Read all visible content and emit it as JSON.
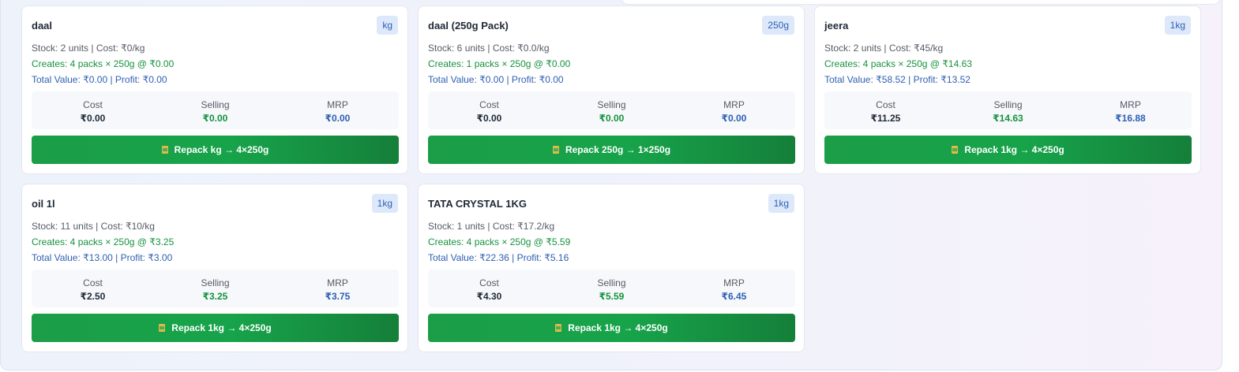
{
  "cards": [
    {
      "title": "daal",
      "badge": "kg",
      "stock": "Stock: 2 units | Cost: ₹0/kg",
      "creates": "Creates: 4 packs × 250g @ ₹0.00",
      "total": "Total Value: ₹0.00 | Profit: ₹0.00",
      "cost_label": "Cost",
      "cost": "₹0.00",
      "selling_label": "Selling",
      "selling": "₹0.00",
      "mrp_label": "MRP",
      "mrp": "₹0.00",
      "button": "Repack kg → 4×250g"
    },
    {
      "title": "daal (250g Pack)",
      "badge": "250g",
      "stock": "Stock: 6 units | Cost: ₹0.0/kg",
      "creates": "Creates: 1 packs × 250g @ ₹0.00",
      "total": "Total Value: ₹0.00 | Profit: ₹0.00",
      "cost_label": "Cost",
      "cost": "₹0.00",
      "selling_label": "Selling",
      "selling": "₹0.00",
      "mrp_label": "MRP",
      "mrp": "₹0.00",
      "button": "Repack 250g → 1×250g"
    },
    {
      "title": "jeera",
      "badge": "1kg",
      "stock": "Stock: 2 units | Cost: ₹45/kg",
      "creates": "Creates: 4 packs × 250g @ ₹14.63",
      "total": "Total Value: ₹58.52 | Profit: ₹13.52",
      "cost_label": "Cost",
      "cost": "₹11.25",
      "selling_label": "Selling",
      "selling": "₹14.63",
      "mrp_label": "MRP",
      "mrp": "₹16.88",
      "button": "Repack 1kg → 4×250g"
    },
    {
      "title": "oil 1l",
      "badge": "1kg",
      "stock": "Stock: 11 units | Cost: ₹10/kg",
      "creates": "Creates: 4 packs × 250g @ ₹3.25",
      "total": "Total Value: ₹13.00 | Profit: ₹3.00",
      "cost_label": "Cost",
      "cost": "₹2.50",
      "selling_label": "Selling",
      "selling": "₹3.25",
      "mrp_label": "MRP",
      "mrp": "₹3.75",
      "button": "Repack 1kg → 4×250g"
    },
    {
      "title": "TATA CRYSTAL 1KG",
      "badge": "1kg",
      "stock": "Stock: 1 units | Cost: ₹17.2/kg",
      "creates": "Creates: 4 packs × 250g @ ₹5.59",
      "total": "Total Value: ₹22.36 | Profit: ₹5.16",
      "cost_label": "Cost",
      "cost": "₹4.30",
      "selling_label": "Selling",
      "selling": "₹5.59",
      "mrp_label": "MRP",
      "mrp": "₹6.45",
      "button": "Repack 1kg → 4×250g"
    }
  ],
  "icons": {
    "repack": "package-icon"
  },
  "colors": {
    "button_green": "#17a34a",
    "profit_blue": "#2f5fb3",
    "creates_green": "#16923f"
  }
}
